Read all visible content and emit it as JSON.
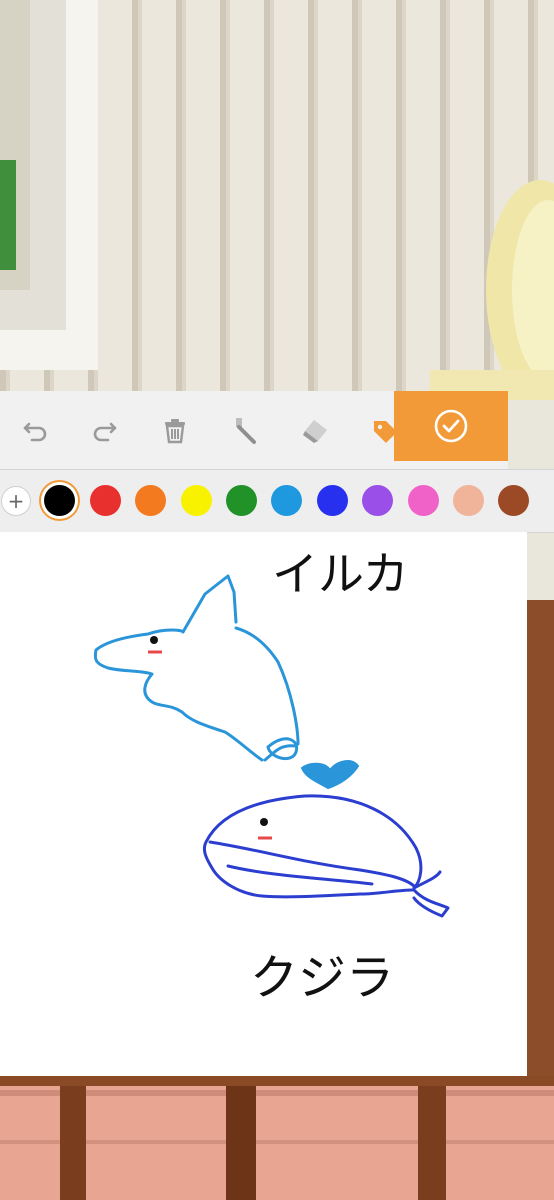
{
  "toolbar": {
    "tools": [
      {
        "name": "undo",
        "icon": "undo-icon"
      },
      {
        "name": "redo",
        "icon": "redo-icon"
      },
      {
        "name": "clear",
        "icon": "trash-icon"
      },
      {
        "name": "eyedropper",
        "icon": "eyedropper-icon"
      },
      {
        "name": "eraser",
        "icon": "eraser-icon"
      },
      {
        "name": "fill",
        "icon": "fill-tag-icon",
        "active": true
      }
    ],
    "done_icon": "check-circle-icon",
    "accent_color": "#f29a38"
  },
  "palette": {
    "add_label": "+",
    "selected": "#000000",
    "colors": [
      "#000000",
      "#e8302e",
      "#f37a1f",
      "#f8f100",
      "#219227",
      "#1e99e0",
      "#2830f0",
      "#9a4fe8",
      "#f162c8",
      "#f0b49a",
      "#9c4a26"
    ]
  },
  "drawing": {
    "labels": {
      "dolphin": "イルカ",
      "whale": "クジラ"
    },
    "colors": {
      "dolphin": "#2a95d9",
      "whale": "#2b3ed0",
      "ink": "#111111",
      "blush": "#e84848"
    }
  }
}
